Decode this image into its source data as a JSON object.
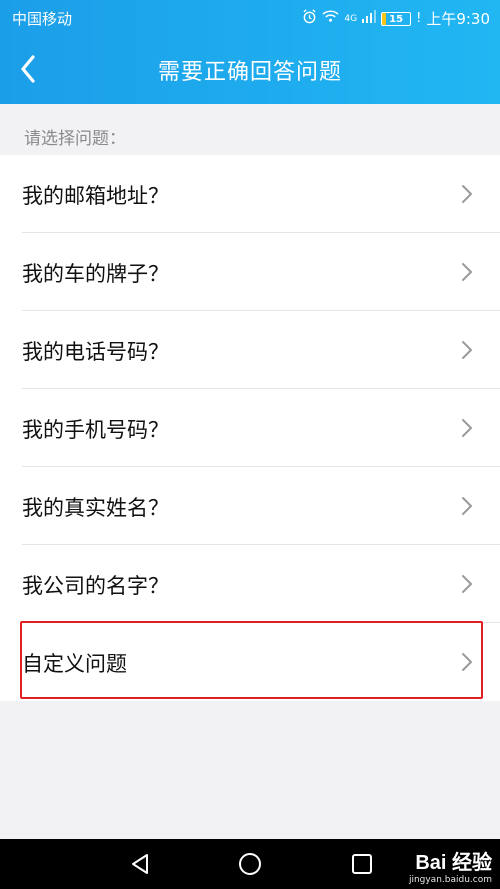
{
  "status_bar": {
    "carrier": "中国移动",
    "network": "4G",
    "battery": "15",
    "time": "上午9:30",
    "icons": [
      "alarm-icon",
      "wifi-icon",
      "signal-icon",
      "battery-icon"
    ]
  },
  "header": {
    "title": "需要正确回答问题",
    "back_icon": "back-arrow-icon"
  },
  "section_label": "请选择问题：",
  "questions": [
    {
      "label": "我的邮箱地址？"
    },
    {
      "label": "我的车的牌子？"
    },
    {
      "label": "我的电话号码？"
    },
    {
      "label": "我的手机号码？"
    },
    {
      "label": "我的真实姓名？"
    },
    {
      "label": "我公司的名字？"
    },
    {
      "label": "自定义问题"
    }
  ],
  "watermark": {
    "main": "Bai 经验",
    "sub": "jingyan.baidu.com"
  },
  "colors": {
    "header_gradient_start": "#1b9ee8",
    "header_gradient_end": "#21b7f3",
    "highlight_border": "#e02020",
    "background": "#f2f2f4"
  }
}
